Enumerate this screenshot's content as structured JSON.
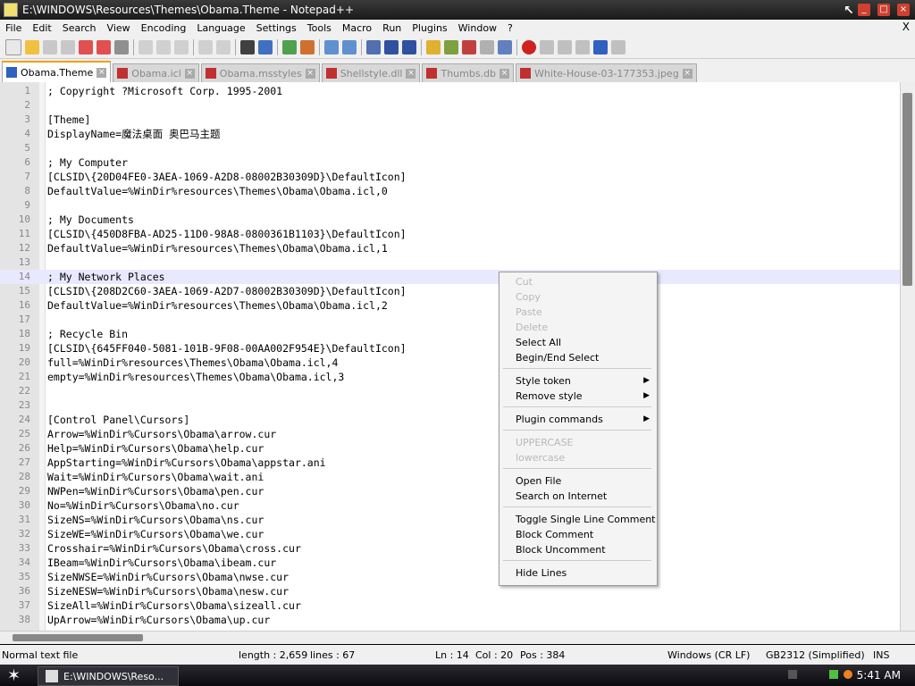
{
  "window": {
    "title": "E:\\WINDOWS\\Resources\\Themes\\Obama.Theme - Notepad++"
  },
  "menu": [
    "File",
    "Edit",
    "Search",
    "View",
    "Encoding",
    "Language",
    "Settings",
    "Tools",
    "Macro",
    "Run",
    "Plugins",
    "Window",
    "?"
  ],
  "menu_close": "X",
  "tabs": [
    {
      "label": "Obama.Theme",
      "active": true
    },
    {
      "label": "Obama.icl",
      "active": false
    },
    {
      "label": "Obama.msstyles",
      "active": false
    },
    {
      "label": "Shellstyle.dll",
      "active": false
    },
    {
      "label": "Thumbs.db",
      "active": false
    },
    {
      "label": "White-House-03-177353.jpeg",
      "active": false
    }
  ],
  "lines": [
    {
      "n": "1",
      "t": "; Copyright ?Microsoft Corp. 1995-2001"
    },
    {
      "n": "2",
      "t": ""
    },
    {
      "n": "3",
      "t": "[Theme]"
    },
    {
      "n": "4",
      "t": "DisplayName=魔法桌面 奥巴马主题"
    },
    {
      "n": "5",
      "t": ""
    },
    {
      "n": "6",
      "t": "; My Computer"
    },
    {
      "n": "7",
      "t": "[CLSID\\{20D04FE0-3AEA-1069-A2D8-08002B30309D}\\DefaultIcon]"
    },
    {
      "n": "8",
      "t": "DefaultValue=%WinDir%resources\\Themes\\Obama\\Obama.icl,0"
    },
    {
      "n": "9",
      "t": ""
    },
    {
      "n": "10",
      "t": "; My Documents"
    },
    {
      "n": "11",
      "t": "[CLSID\\{450D8FBA-AD25-11D0-98A8-0800361B1103}\\DefaultIcon]"
    },
    {
      "n": "12",
      "t": "DefaultValue=%WinDir%resources\\Themes\\Obama\\Obama.icl,1"
    },
    {
      "n": "13",
      "t": ""
    },
    {
      "n": "14",
      "t": "; My Network Places"
    },
    {
      "n": "15",
      "t": "[CLSID\\{208D2C60-3AEA-1069-A2D7-08002B30309D}\\DefaultIcon]"
    },
    {
      "n": "16",
      "t": "DefaultValue=%WinDir%resources\\Themes\\Obama\\Obama.icl,2"
    },
    {
      "n": "17",
      "t": ""
    },
    {
      "n": "18",
      "t": "; Recycle Bin"
    },
    {
      "n": "19",
      "t": "[CLSID\\{645FF040-5081-101B-9F08-00AA002F954E}\\DefaultIcon]"
    },
    {
      "n": "20",
      "t": "full=%WinDir%resources\\Themes\\Obama\\Obama.icl,4"
    },
    {
      "n": "21",
      "t": "empty=%WinDir%resources\\Themes\\Obama\\Obama.icl,3"
    },
    {
      "n": "22",
      "t": ""
    },
    {
      "n": "23",
      "t": ""
    },
    {
      "n": "24",
      "t": "[Control Panel\\Cursors]"
    },
    {
      "n": "25",
      "t": "Arrow=%WinDir%Cursors\\Obama\\arrow.cur"
    },
    {
      "n": "26",
      "t": "Help=%WinDir%Cursors\\Obama\\help.cur"
    },
    {
      "n": "27",
      "t": "AppStarting=%WinDir%Cursors\\Obama\\appstar.ani"
    },
    {
      "n": "28",
      "t": "Wait=%WinDir%Cursors\\Obama\\wait.ani"
    },
    {
      "n": "29",
      "t": "NWPen=%WinDir%Cursors\\Obama\\pen.cur"
    },
    {
      "n": "30",
      "t": "No=%WinDir%Cursors\\Obama\\no.cur"
    },
    {
      "n": "31",
      "t": "SizeNS=%WinDir%Cursors\\Obama\\ns.cur"
    },
    {
      "n": "32",
      "t": "SizeWE=%WinDir%Cursors\\Obama\\we.cur"
    },
    {
      "n": "33",
      "t": "Crosshair=%WinDir%Cursors\\Obama\\cross.cur"
    },
    {
      "n": "34",
      "t": "IBeam=%WinDir%Cursors\\Obama\\ibeam.cur"
    },
    {
      "n": "35",
      "t": "SizeNWSE=%WinDir%Cursors\\Obama\\nwse.cur"
    },
    {
      "n": "36",
      "t": "SizeNESW=%WinDir%Cursors\\Obama\\nesw.cur"
    },
    {
      "n": "37",
      "t": "SizeAll=%WinDir%Cursors\\Obama\\sizeall.cur"
    },
    {
      "n": "38",
      "t": "UpArrow=%WinDir%Cursors\\Obama\\up.cur"
    }
  ],
  "current_line": "14",
  "context_menu": {
    "cut": "Cut",
    "copy": "Copy",
    "paste": "Paste",
    "delete": "Delete",
    "select_all": "Select All",
    "begin_end_select": "Begin/End Select",
    "style_token": "Style token",
    "remove_style": "Remove style",
    "plugin_commands": "Plugin commands",
    "uppercase": "UPPERCASE",
    "lowercase": "lowercase",
    "open_file": "Open File",
    "search_internet": "Search on Internet",
    "toggle_comment": "Toggle Single Line Comment",
    "block_comment": "Block Comment",
    "block_uncomment": "Block Uncomment",
    "hide_lines": "Hide Lines"
  },
  "status": {
    "type": "Normal text file",
    "length": "length : 2,659",
    "lines": "lines : 67",
    "ln": "Ln : 14",
    "col": "Col : 20",
    "pos": "Pos : 384",
    "eol": "Windows (CR LF)",
    "encoding": "GB2312 (Simplified)",
    "mode": "INS"
  },
  "taskbar": {
    "task_label": "E:\\WINDOWS\\Reso...",
    "clock": "5:41 AM"
  },
  "colors": {
    "current_line": "#e8e8ff",
    "active_tab_accent": "#f0a000",
    "gutter": "#e4e4e4"
  }
}
